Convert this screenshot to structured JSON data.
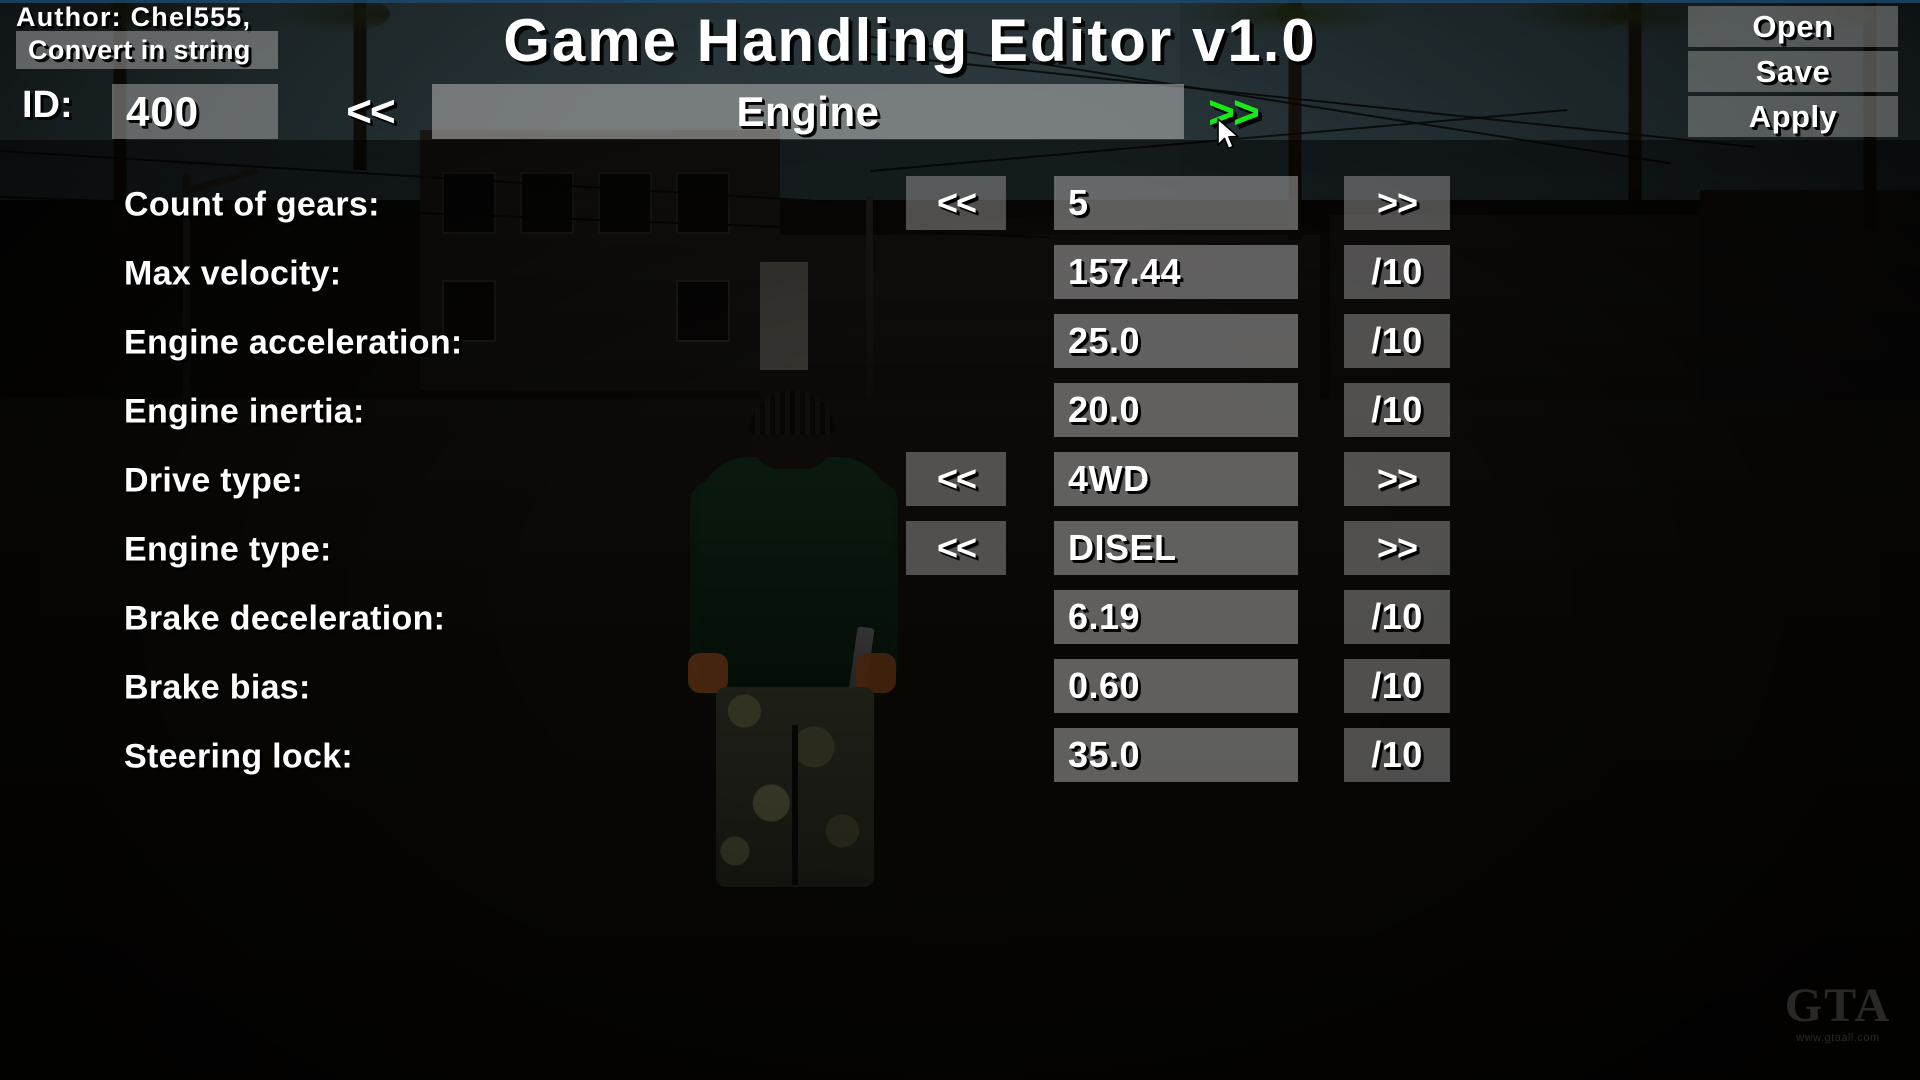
{
  "window": {
    "title": "Game Handling Editor v1.0",
    "author_line": "Author: Chel555,",
    "convert_button": "Convert in string"
  },
  "topbar": {
    "id_label": "ID:",
    "id_value": "400",
    "category_prev": "<<",
    "category_name": "Engine",
    "category_next": ">>",
    "category_next_color": "#16e916"
  },
  "file_buttons": [
    {
      "label": "Open",
      "name": "open-button"
    },
    {
      "label": "Save",
      "name": "save-button"
    },
    {
      "label": "Apply",
      "name": "apply-button"
    }
  ],
  "parameters": [
    {
      "label": "Count of gears:",
      "dec": "<<",
      "has_dec": true,
      "value": "5",
      "inc": ">>"
    },
    {
      "label": "Max velocity:",
      "dec": "<<",
      "has_dec": false,
      "value": "157.44",
      "inc": "/10"
    },
    {
      "label": "Engine acceleration:",
      "dec": "<<",
      "has_dec": false,
      "value": "25.0",
      "inc": "/10"
    },
    {
      "label": "Engine inertia:",
      "dec": "<<",
      "has_dec": false,
      "value": "20.0",
      "inc": "/10"
    },
    {
      "label": "Drive type:",
      "dec": "<<",
      "has_dec": true,
      "value": "4WD",
      "inc": ">>"
    },
    {
      "label": "Engine type:",
      "dec": "<<",
      "has_dec": true,
      "value": "DISEL",
      "inc": ">>"
    },
    {
      "label": "Brake deceleration:",
      "dec": "<<",
      "has_dec": false,
      "value": "6.19",
      "inc": "/10"
    },
    {
      "label": "Brake bias:",
      "dec": "<<",
      "has_dec": false,
      "value": "0.60",
      "inc": "/10"
    },
    {
      "label": "Steering lock:",
      "dec": "<<",
      "has_dec": false,
      "value": "35.0",
      "inc": "/10"
    }
  ],
  "watermark": {
    "logo": "GTA",
    "url": "www.gtaall.com"
  },
  "colors": {
    "panel": "rgba(168,168,168,0.55)",
    "text": "#ffffff",
    "accent_green": "#16e916"
  }
}
